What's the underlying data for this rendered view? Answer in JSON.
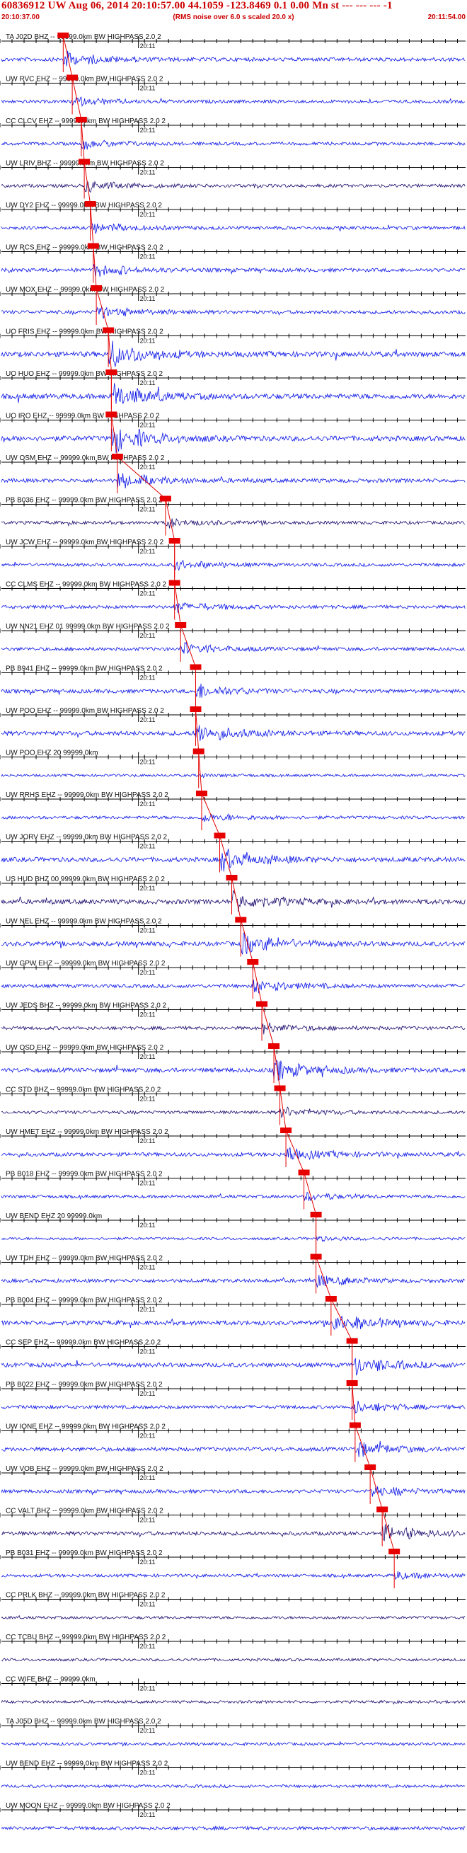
{
  "header": {
    "title": "60836912 UW Aug 06, 2014 20:10:57.00   44.1059 -123.8469  0.1 0.00 Mn st --- --- ---  -1",
    "start_time": "20:10:37.00",
    "note": "(RMS noise over 6.0 s scaled 20.0 x)",
    "end_time": "20:11:54.00"
  },
  "colors": {
    "trace_blue": "#0a14e6",
    "trace_dark": "#1a0a6e",
    "pick_red": "#e60000",
    "axis": "#000000"
  },
  "chart_data": {
    "type": "line",
    "title": "60836912 UW Aug 06, 2014 20:10:57.00   44.1059 -123.8469  0.1 0.00 Mn st --- --- ---  -1",
    "x_range": [
      "20:10:37.00",
      "20:11:54.00"
    ],
    "minute_marker": "20:11",
    "traces": [
      {
        "label": "TA J02D BHZ -- 99999.0km BW  HIGHPASS  2.0  2",
        "pick": 10.5,
        "color": "blue",
        "energy": 0.55
      },
      {
        "label": "UW RVC EHZ -- 99999.0km BW  HIGHPASS  2.0  2",
        "pick": 12.0,
        "color": "blue",
        "energy": 0.35
      },
      {
        "label": "CC CLCV EHZ -- 99999.0km BW  HIGHPASS  2.0  2",
        "pick": 13.5,
        "color": "blue",
        "energy": 0.35
      },
      {
        "label": "UW LRIV BHZ -- 99999.0km BW  HIGHPASS  2.0  2",
        "pick": 14.0,
        "color": "dark",
        "energy": 0.4
      },
      {
        "label": "UW DY2 EHZ -- 99999.0km BW  HIGHPASS  2.0  2",
        "pick": 15.0,
        "color": "blue",
        "energy": 0.4
      },
      {
        "label": "UW RCS EHZ -- 99999.0km BW  HIGHPASS  2.0  2",
        "pick": 15.5,
        "color": "blue",
        "energy": 0.5
      },
      {
        "label": "UW MOX EHZ -- 99999.0km BW  HIGHPASS  2.0  2",
        "pick": 16.0,
        "color": "blue",
        "energy": 0.45
      },
      {
        "label": "UO FRIS EHZ -- 99999.0km BW  HIGHPASS  2.0  2",
        "pick": 18.0,
        "color": "blue",
        "energy": 1.0
      },
      {
        "label": "UO HUO EHZ -- 99999.0km BW  HIGHPASS  2.0  2",
        "pick": 18.5,
        "color": "blue",
        "energy": 1.0
      },
      {
        "label": "UO IRO EHZ -- 99999.0km BW  HIGHPASS  2.0  2",
        "pick": 18.5,
        "color": "blue",
        "energy": 1.0
      },
      {
        "label": "UW OSM EHZ -- 99999.0km BW  HIGHPASS  2.0  2",
        "pick": 19.5,
        "color": "blue",
        "energy": 0.6
      },
      {
        "label": "PB B036 EHZ -- 99999.0km BW  HIGHPASS  2.0  2",
        "pick": 27.5,
        "color": "dark",
        "energy": 0.35
      },
      {
        "label": "UW JCW EHZ -- 99999.0km BW  HIGHPASS  2.0  2",
        "pick": 29.0,
        "color": "blue",
        "energy": 0.35
      },
      {
        "label": "CC CLMS EHZ -- 99999.0km BW  HIGHPASS  2.0  2",
        "pick": 29.0,
        "color": "blue",
        "energy": 0.4
      },
      {
        "label": "UW NN21 EHZ 01 99999.0km BW  HIGHPASS  2.0  2",
        "pick": 30.0,
        "color": "blue",
        "energy": 0.45
      },
      {
        "label": "PB B941 EHZ -- 99999.0km BW  HIGHPASS  2.0  2",
        "pick": 32.5,
        "color": "blue",
        "energy": 0.55
      },
      {
        "label": "UW POO EHZ -- 99999.0km BW  HIGHPASS  2.0  2",
        "pick": 32.5,
        "color": "blue",
        "energy": 0.75
      },
      {
        "label": "UW POO EHZ 20 99999.0km",
        "pick": 33.0,
        "color": "blue",
        "energy": 0.1
      },
      {
        "label": "UW RRHS EHZ -- 99999.0km BW  HIGHPASS  2.0  2",
        "pick": 33.5,
        "color": "blue",
        "energy": 0.3
      },
      {
        "label": "UW JORV EHZ -- 99999.0km BW  HIGHPASS  2.0  2",
        "pick": 36.5,
        "color": "blue",
        "energy": 0.85
      },
      {
        "label": "US HUD BHZ 00 99999.0km BW  HIGHPASS  2.0  2",
        "pick": 38.5,
        "color": "dark",
        "energy": 0.85
      },
      {
        "label": "UW NEL EHZ -- 99999.0km BW  HIGHPASS  2.0  2",
        "pick": 40.0,
        "color": "blue",
        "energy": 0.8
      },
      {
        "label": "UW GPW EHZ -- 99999.0km BW  HIGHPASS  2.0  2",
        "pick": 42.0,
        "color": "blue",
        "energy": 0.5
      },
      {
        "label": "UW JEDS BHZ -- 99999.0km BW  HIGHPASS  2.0  2",
        "pick": 43.5,
        "color": "dark",
        "energy": 0.4
      },
      {
        "label": "UW OSD EHZ -- 99999.0km BW  HIGHPASS  2.0  2",
        "pick": 45.5,
        "color": "blue",
        "energy": 0.75
      },
      {
        "label": "CC STD BHZ -- 99999.0km BW  HIGHPASS  2.0  2",
        "pick": 46.5,
        "color": "dark",
        "energy": 0.35
      },
      {
        "label": "UW HMET EHZ -- 99999.0km BW  HIGHPASS  2.0  2",
        "pick": 47.5,
        "color": "blue",
        "energy": 0.55
      },
      {
        "label": "PB B018 EHZ -- 99999.0km BW  HIGHPASS  2.0  2",
        "pick": 50.5,
        "color": "blue",
        "energy": 0.3
      },
      {
        "label": "UW BEND EHZ 20 99999.0km",
        "pick": 52.5,
        "color": "blue",
        "energy": 0.15
      },
      {
        "label": "UW TDH EHZ -- 99999.0km BW  HIGHPASS  2.0  2",
        "pick": 52.5,
        "color": "blue",
        "energy": 0.45
      },
      {
        "label": "PB B004 EHZ -- 99999.0km BW  HIGHPASS  2.0  2",
        "pick": 55.0,
        "color": "blue",
        "energy": 0.75
      },
      {
        "label": "CC SEP EHZ -- 99999.0km BW  HIGHPASS  2.0  2",
        "pick": 58.5,
        "color": "blue",
        "energy": 0.7
      },
      {
        "label": "PB B022 EHZ -- 99999.0km BW  HIGHPASS  2.0  2",
        "pick": 58.5,
        "color": "blue",
        "energy": 0.45
      },
      {
        "label": "UW IONE EHZ -- 99999.0km BW  HIGHPASS  2.0  2",
        "pick": 59.0,
        "color": "blue",
        "energy": 0.6
      },
      {
        "label": "UW VOB EHZ -- 99999.0km BW  HIGHPASS  2.0  2",
        "pick": 61.5,
        "color": "blue",
        "energy": 0.45
      },
      {
        "label": "CC VALT BHZ -- 99999.0km BW  HIGHPASS  2.0  2",
        "pick": 63.5,
        "color": "dark",
        "energy": 0.6
      },
      {
        "label": "PB B031 EHZ -- 99999.0km BW  HIGHPASS  2.0  2",
        "pick": 65.5,
        "color": "blue",
        "energy": 0.3
      },
      {
        "label": "CC PRLK BHZ -- 99999.0km BW  HIGHPASS  2.0  2",
        "pick": null,
        "color": "dark",
        "energy": 0.2
      },
      {
        "label": "CC TCBU BHZ -- 99999.0km BW  HIGHPASS  2.0  2",
        "pick": null,
        "color": "dark",
        "energy": 0.2
      },
      {
        "label": "CC WIFE BHZ -- 99999.0km",
        "pick": null,
        "color": "dark",
        "energy": 0.2
      },
      {
        "label": "TA J05D BHZ -- 99999.0km BW  HIGHPASS  2.0  2",
        "pick": null,
        "color": "blue",
        "energy": 0.25
      },
      {
        "label": "UW BEND EHZ -- 99999.0km BW  HIGHPASS  2.0  2",
        "pick": null,
        "color": "blue",
        "energy": 0.25
      },
      {
        "label": "UW MOON EHZ -- 99999.0km BW  HIGHPASS  2.0  2",
        "pick": null,
        "color": "blue",
        "energy": 0.45
      }
    ]
  }
}
